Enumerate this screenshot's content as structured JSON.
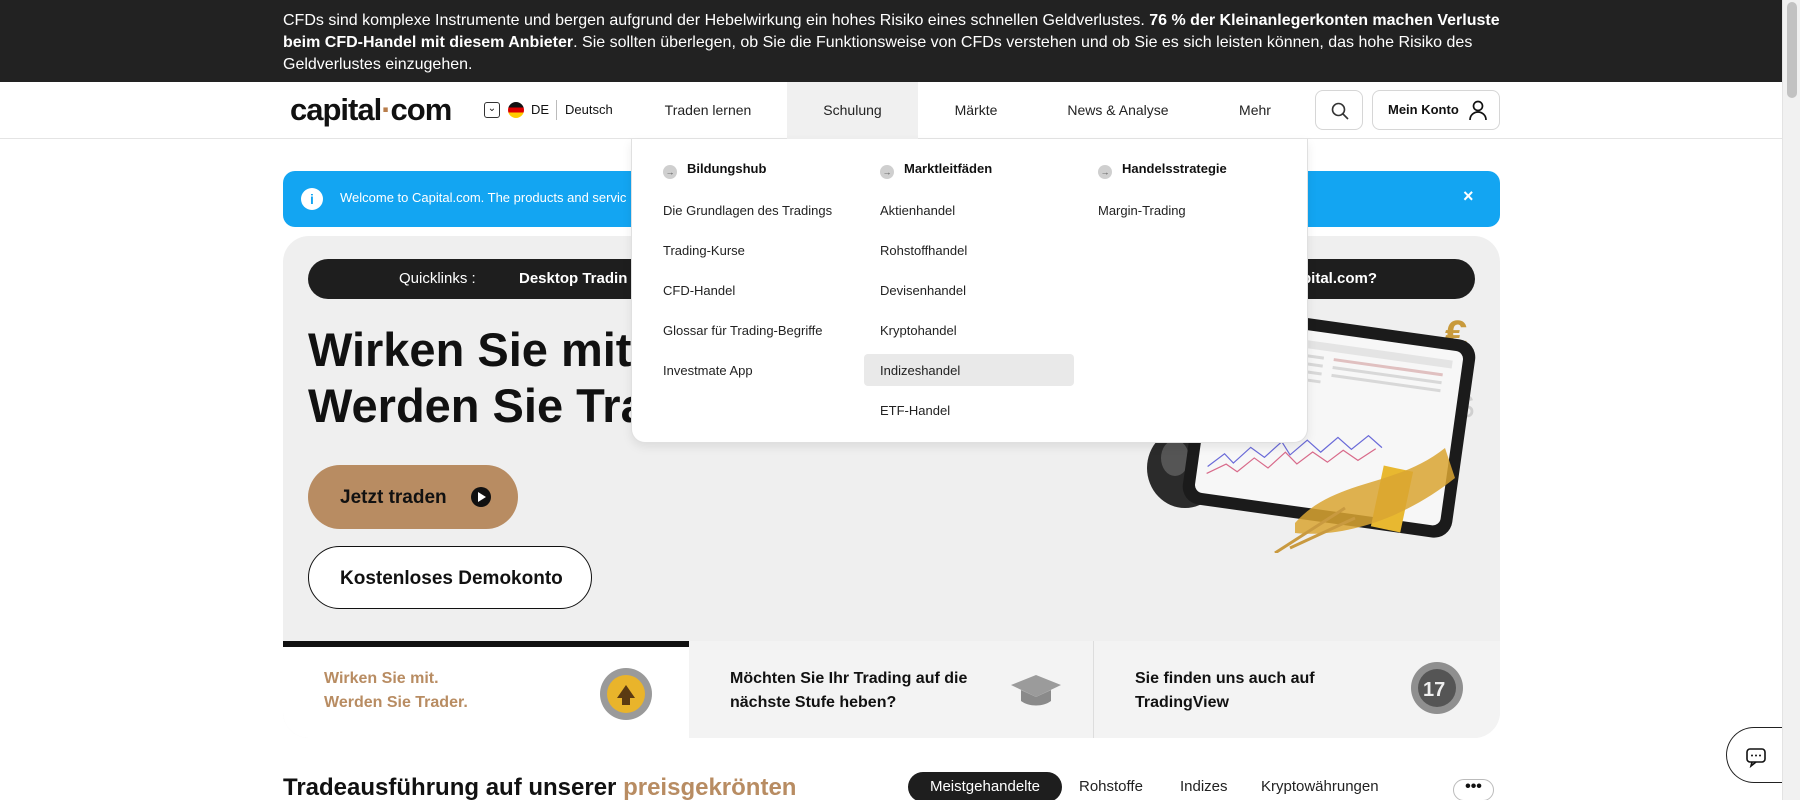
{
  "risk_banner": {
    "text_1": "CFDs sind komplexe Instrumente und bergen aufgrund der Hebelwirkung ein hohes Risiko eines schnellen Geldverlustes. ",
    "text_bold": "76 % der Kleinanlegerkonten machen Verluste beim CFD-Handel mit diesem Anbieter",
    "text_2": ". Sie sollten überlegen, ob Sie die Funktionsweise von CFDs verstehen und ob Sie es sich leisten können, das hohe Risiko des Geldverlustes einzugehen."
  },
  "header": {
    "logo_left": "capital",
    "logo_dot": "·",
    "logo_right": "com",
    "lang_code": "DE",
    "lang_name": "Deutsch",
    "nav": [
      "Traden lernen",
      "Schulung",
      "Märkte",
      "News & Analyse",
      "Mehr"
    ],
    "account_label": "Mein Konto"
  },
  "welcome": {
    "info_glyph": "i",
    "text": "Welcome to Capital.com. The products and servic",
    "close_glyph": "×"
  },
  "hero": {
    "quicklinks_label": "Quicklinks :",
    "quicklink_1": "Desktop Tradin",
    "quicklink_2": "pital.com?",
    "headline_1": "Wirken Sie mit",
    "headline_2": "Werden Sie Tra",
    "trade_button": "Jetzt traden",
    "demo_button": "Kostenloses Demokonto"
  },
  "features": {
    "f1": "Wirken Sie mit.\nWerden Sie Trader.",
    "f2": "Möchten Sie Ihr Trading auf die\nnächste Stufe heben?",
    "f3": "Sie finden uns auch auf\nTradingView"
  },
  "bottom": {
    "title_1": "Tradeausführung auf unserer ",
    "title_accent": "preisgekrönten",
    "tabs": [
      "Meistgehandelte",
      "Rohstoffe",
      "Indizes",
      "Kryptowährungen"
    ],
    "more_glyph": "•••"
  },
  "dropdown": {
    "columns": [
      {
        "heading": "Bildungshub",
        "items": [
          "Die Grundlagen des Tradings",
          "Trading-Kurse",
          "CFD-Handel",
          "Glossar für Trading-Begriffe",
          "Investmate App"
        ]
      },
      {
        "heading": "Marktleitfäden",
        "items": [
          "Aktienhandel",
          "Rohstoffhandel",
          "Devisenhandel",
          "Kryptohandel",
          "Indizeshandel",
          "ETF-Handel"
        ]
      },
      {
        "heading": "Handelsstrategie",
        "items": [
          "Margin-Trading"
        ]
      }
    ],
    "arrow_glyph": "→",
    "highlighted_item": "Indizeshandel"
  },
  "colors": {
    "accent_brown": "#b88c62",
    "welcome_blue": "#13a5f2",
    "banner_dark": "#222222"
  }
}
